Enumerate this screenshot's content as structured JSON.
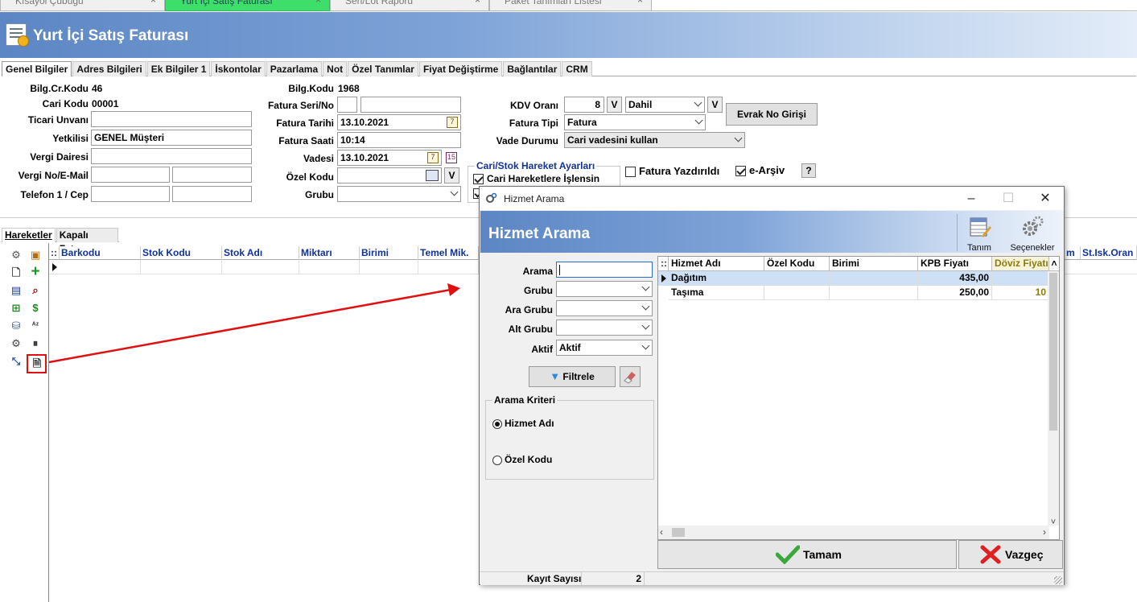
{
  "doc_tabs": [
    {
      "label": "Kısayol Çubuğu",
      "active": false
    },
    {
      "label": "Yurt İçi Satış Faturası",
      "active": true
    },
    {
      "label": "Seri/Lot Raporu",
      "active": false
    },
    {
      "label": "Paket Tanımları Listesi",
      "active": false
    }
  ],
  "doc_tab_close": "×",
  "window_title": "Yurt İçi Satış Faturası",
  "form_tabs": [
    "Genel Bilgiler",
    "Adres Bilgileri",
    "Ek Bilgiler 1",
    "İskontolar",
    "Pazarlama",
    "Not",
    "Özel Tanımlar",
    "Fiyat Değiştirme",
    "Bağlantılar",
    "CRM"
  ],
  "left_fields": {
    "bilg_cr_kodu_label": "Bilg.Cr.Kodu",
    "bilg_cr_kodu": "46",
    "cari_kodu_label": "Cari Kodu",
    "cari_kodu": "00001",
    "ticari_unvani_label": "Ticari Unvanı",
    "ticari_unvani": "",
    "yetkilisi_label": "Yetkilisi",
    "yetkilisi": "GENEL Müşteri",
    "vergi_dairesi_label": "Vergi Dairesi",
    "vergi_dairesi": "",
    "vergi_no_label": "Vergi No/E-Mail",
    "telefon_label": "Telefon 1 / Cep"
  },
  "mid_fields": {
    "bilg_kodu_label": "Bilg.Kodu",
    "bilg_kodu": "1968",
    "fatura_seri_label": "Fatura Seri/No",
    "fatura_tarihi_label": "Fatura Tarihi",
    "fatura_tarihi": "13.10.2021",
    "fatura_saati_label": "Fatura Saati",
    "fatura_saati": "10:14",
    "vadesi_label": "Vadesi",
    "vadesi": "13.10.2021",
    "ozel_kodu_label": "Özel Kodu",
    "grubu_label": "Grubu",
    "v_label": "V"
  },
  "right_fields": {
    "kdv_orani_label": "KDV Oranı",
    "kdv_orani": "8",
    "kdv_type": "Dahil",
    "fatura_tipi_label": "Fatura Tipi",
    "fatura_tipi": "Fatura",
    "vade_durumu_label": "Vade Durumu",
    "vade_durumu": "Cari vadesini kullan",
    "evrak_no_button": "Evrak No Girişi",
    "cari_stok_title": "Cari/Stok Hareket Ayarları",
    "cari_hareket_label": "Cari Hareketlere İşlensin",
    "fatura_yazdirildi_label": "Fatura Yazdırıldı",
    "e_arsiv_label": "e-Arşiv",
    "help_label": "?"
  },
  "grid_tabs": [
    "Hareketler",
    "Kapalı Fatura"
  ],
  "grid_columns": [
    "Barkodu",
    "Stok Kodu",
    "Stok Adı",
    "Miktarı",
    "Birimi",
    "Temel Mik."
  ],
  "grid_columns_right": [
    "m",
    "St.Isk.Oran ("
  ],
  "grid_corner": "::",
  "dialog": {
    "window_title": "Hizmet Arama",
    "header_title": "Hizmet Arama",
    "tool_tanim": "Tanım",
    "tool_secenekler": "Seçenekler",
    "arama_label": "Arama",
    "arama_value": "",
    "grubu_label": "Grubu",
    "ara_grubu_label": "Ara Grubu",
    "alt_grubu_label": "Alt Grubu",
    "aktif_label": "Aktif",
    "aktif_value": "Aktif",
    "filtrele_button": "Filtrele",
    "arama_kriteri_title": "Arama Kriteri",
    "radio_hizmet_adi": "Hizmet Adı",
    "radio_ozel_kodu": "Özel Kodu",
    "columns": [
      "Hizmet Adı",
      "Özel Kodu",
      "Birimi",
      "KPB Fiyatı",
      "Döviz Fiyatı"
    ],
    "rows": [
      {
        "hizmet_adi": "Dağıtım",
        "ozel_kodu": "",
        "birimi": "",
        "kpb_fiyati": "435,00",
        "doviz_fiyati": ""
      },
      {
        "hizmet_adi": "Taşıma",
        "ozel_kodu": "",
        "birimi": "",
        "kpb_fiyati": "250,00",
        "doviz_fiyati": "10"
      }
    ],
    "tamam_button": "Tamam",
    "vazgec_button": "Vazgeç",
    "kayit_sayisi_label": "Kayıt Sayısı",
    "kayit_sayisi": "2"
  },
  "colors": {
    "title_gradient_start": "#5c86c4",
    "active_tab": "#3ede6a",
    "highlight_box": "#e01010",
    "grid_header_text": "#113399"
  }
}
